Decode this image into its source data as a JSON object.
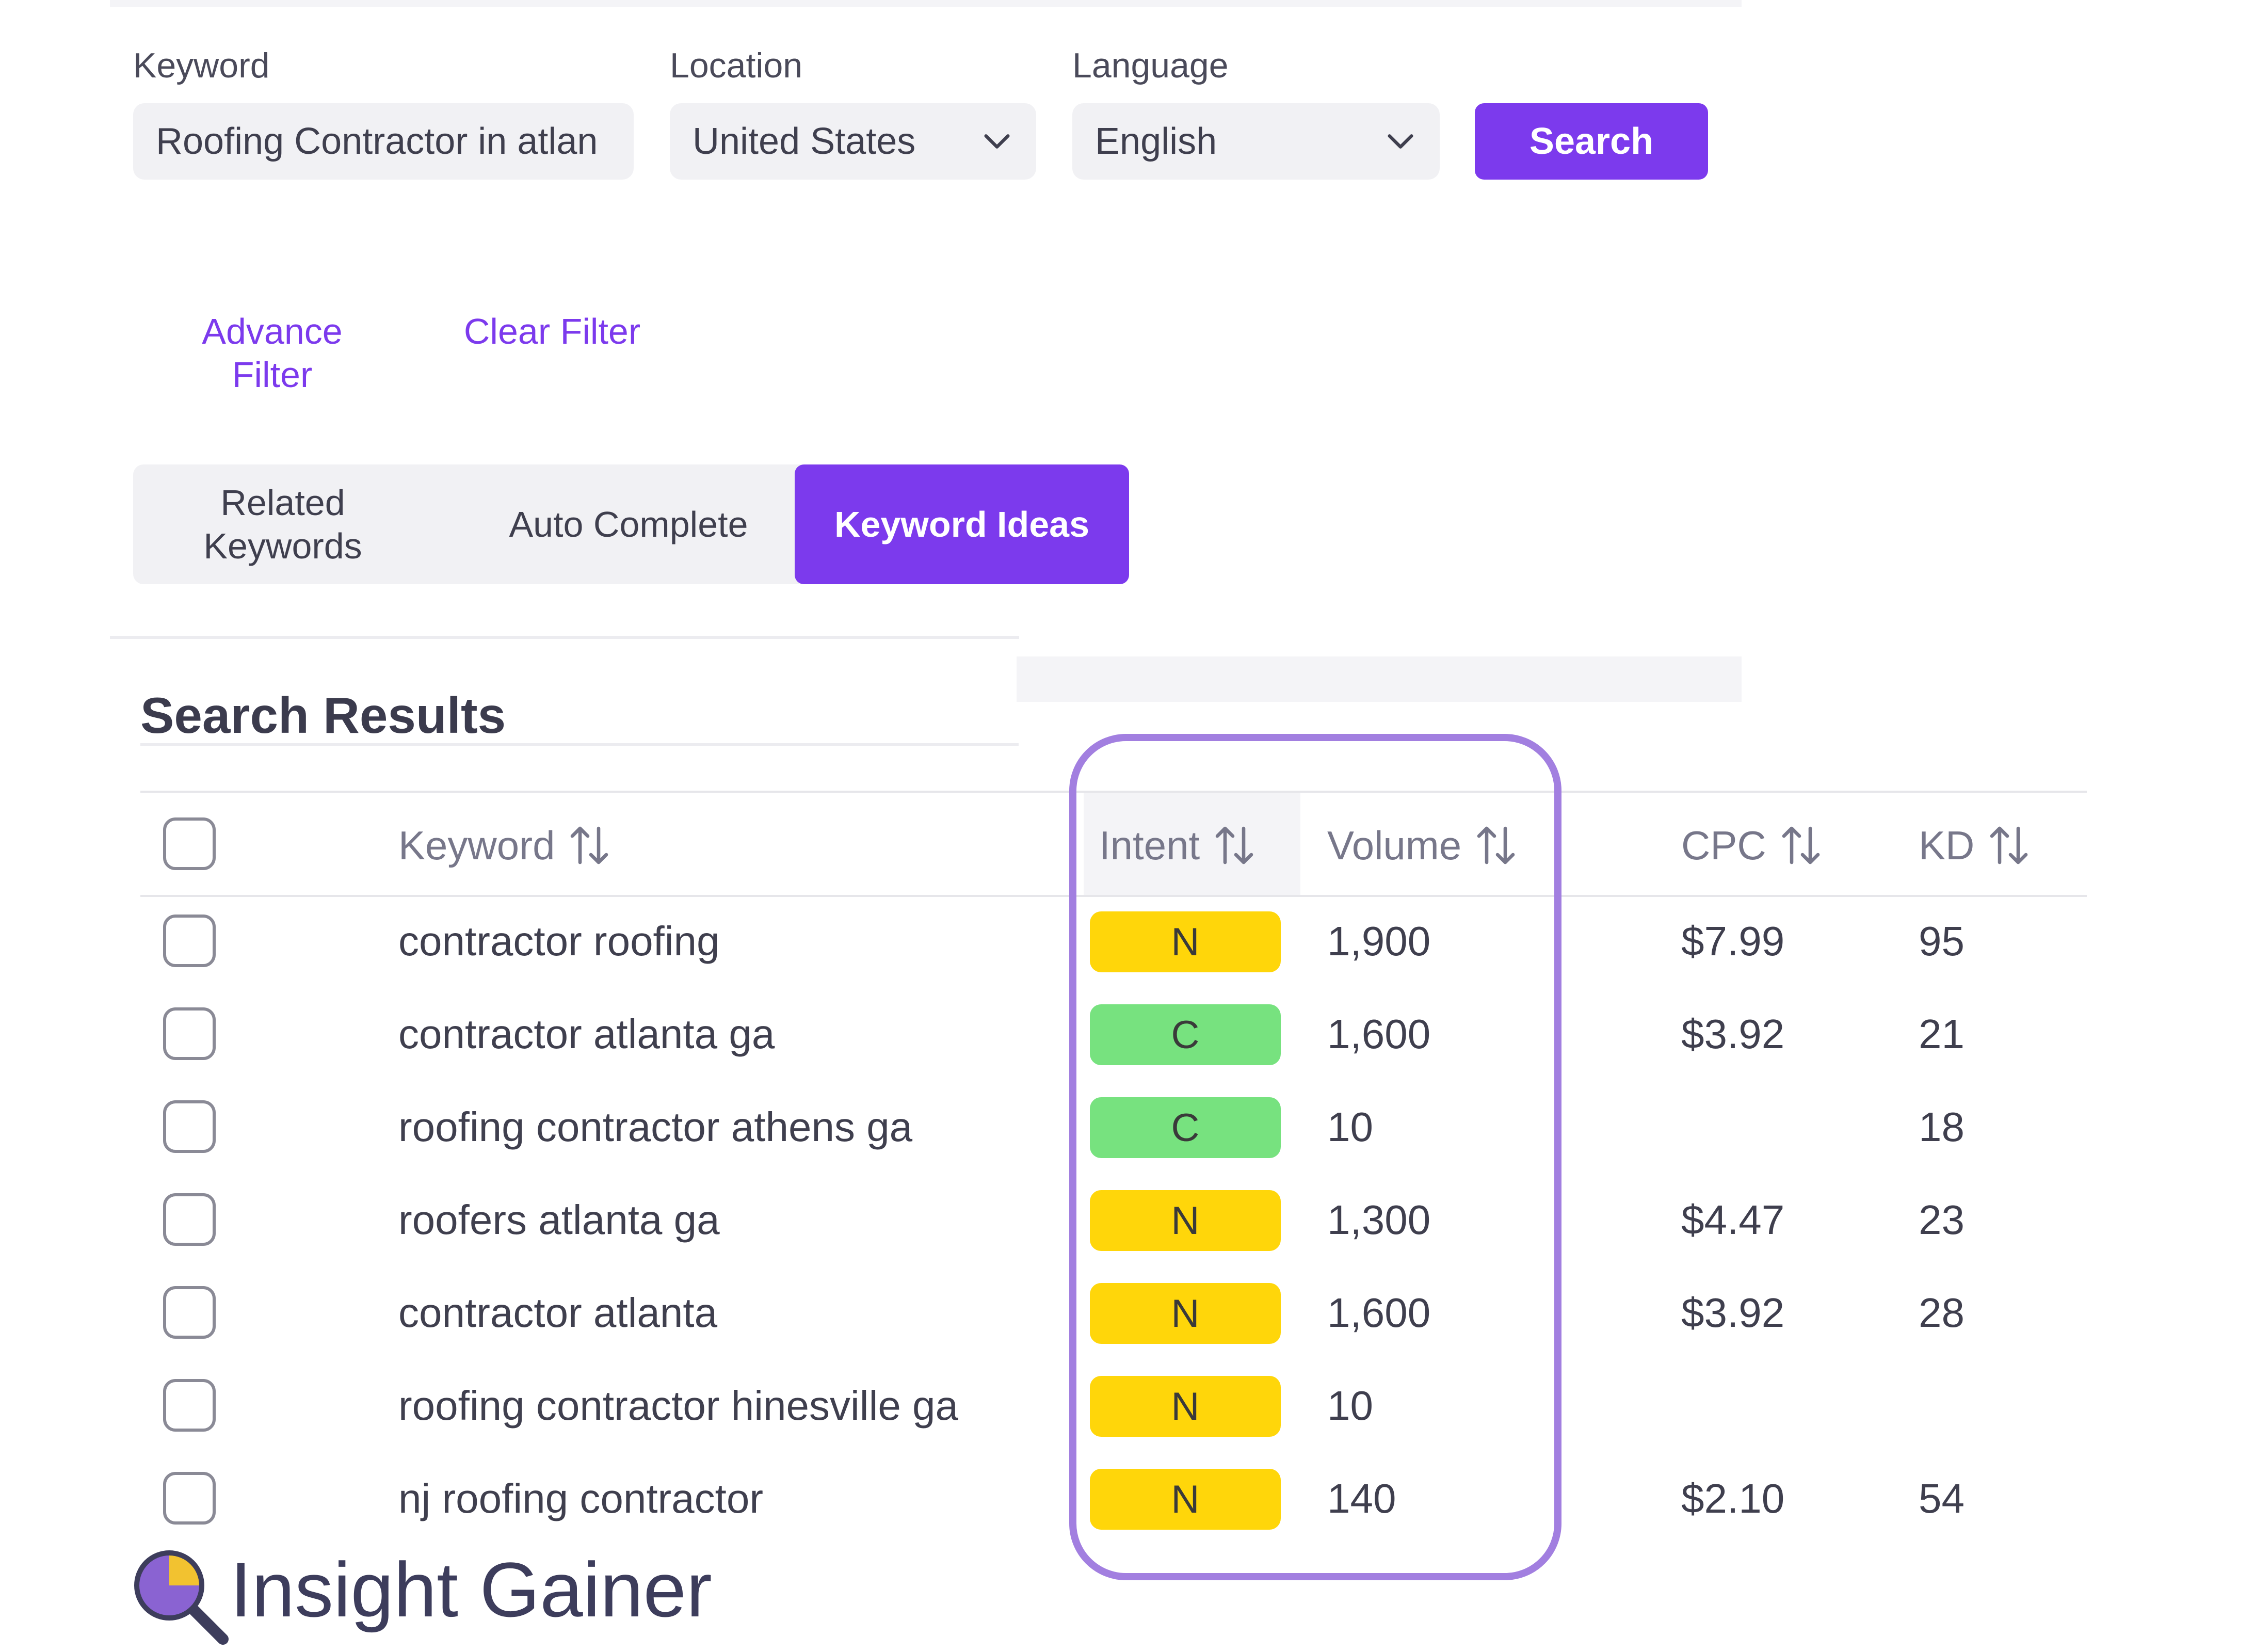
{
  "search_form": {
    "keyword_label": "Keyword",
    "keyword_value": "Roofing Contractor in atlan",
    "location_label": "Location",
    "location_value": "United States",
    "language_label": "Language",
    "language_value": "English",
    "search_label": "Search"
  },
  "filters": {
    "advance_filter_line1": "Advance",
    "advance_filter_line2": "Filter",
    "clear_filter": "Clear Filter"
  },
  "tabs": [
    {
      "line1": "Related",
      "line2": "Keywords",
      "active": false
    },
    {
      "line1": "Auto Complete",
      "line2": "",
      "active": false
    },
    {
      "line1": "Keyword Ideas",
      "line2": "",
      "active": true
    }
  ],
  "results": {
    "title": "Search Results",
    "columns": {
      "keyword": "Keyword",
      "intent": "Intent",
      "volume": "Volume",
      "cpc": "CPC",
      "kd": "KD"
    },
    "rows": [
      {
        "keyword": "contractor roofing",
        "intent": "N",
        "volume": "1,900",
        "cpc": "$7.99",
        "kd": "95"
      },
      {
        "keyword": "contractor atlanta ga",
        "intent": "C",
        "volume": "1,600",
        "cpc": "$3.92",
        "kd": "21"
      },
      {
        "keyword": "roofing contractor athens ga",
        "intent": "C",
        "volume": "10",
        "cpc": "",
        "kd": "18"
      },
      {
        "keyword": "roofers atlanta ga",
        "intent": "N",
        "volume": "1,300",
        "cpc": "$4.47",
        "kd": "23"
      },
      {
        "keyword": "contractor atlanta",
        "intent": "N",
        "volume": "1,600",
        "cpc": "$3.92",
        "kd": "28"
      },
      {
        "keyword": "roofing contractor hinesville ga",
        "intent": "N",
        "volume": "10",
        "cpc": "",
        "kd": ""
      },
      {
        "keyword": "nj roofing contractor",
        "intent": "N",
        "volume": "140",
        "cpc": "$2.10",
        "kd": "54"
      }
    ]
  },
  "intent_colors": {
    "N": "#ffd60a",
    "C": "#77e27f"
  },
  "accent_color": "#7c3aed",
  "highlight_color": "#a27fe0",
  "logo": {
    "text": "Insight Gainer",
    "icon": "magnifier-pie-icon"
  }
}
